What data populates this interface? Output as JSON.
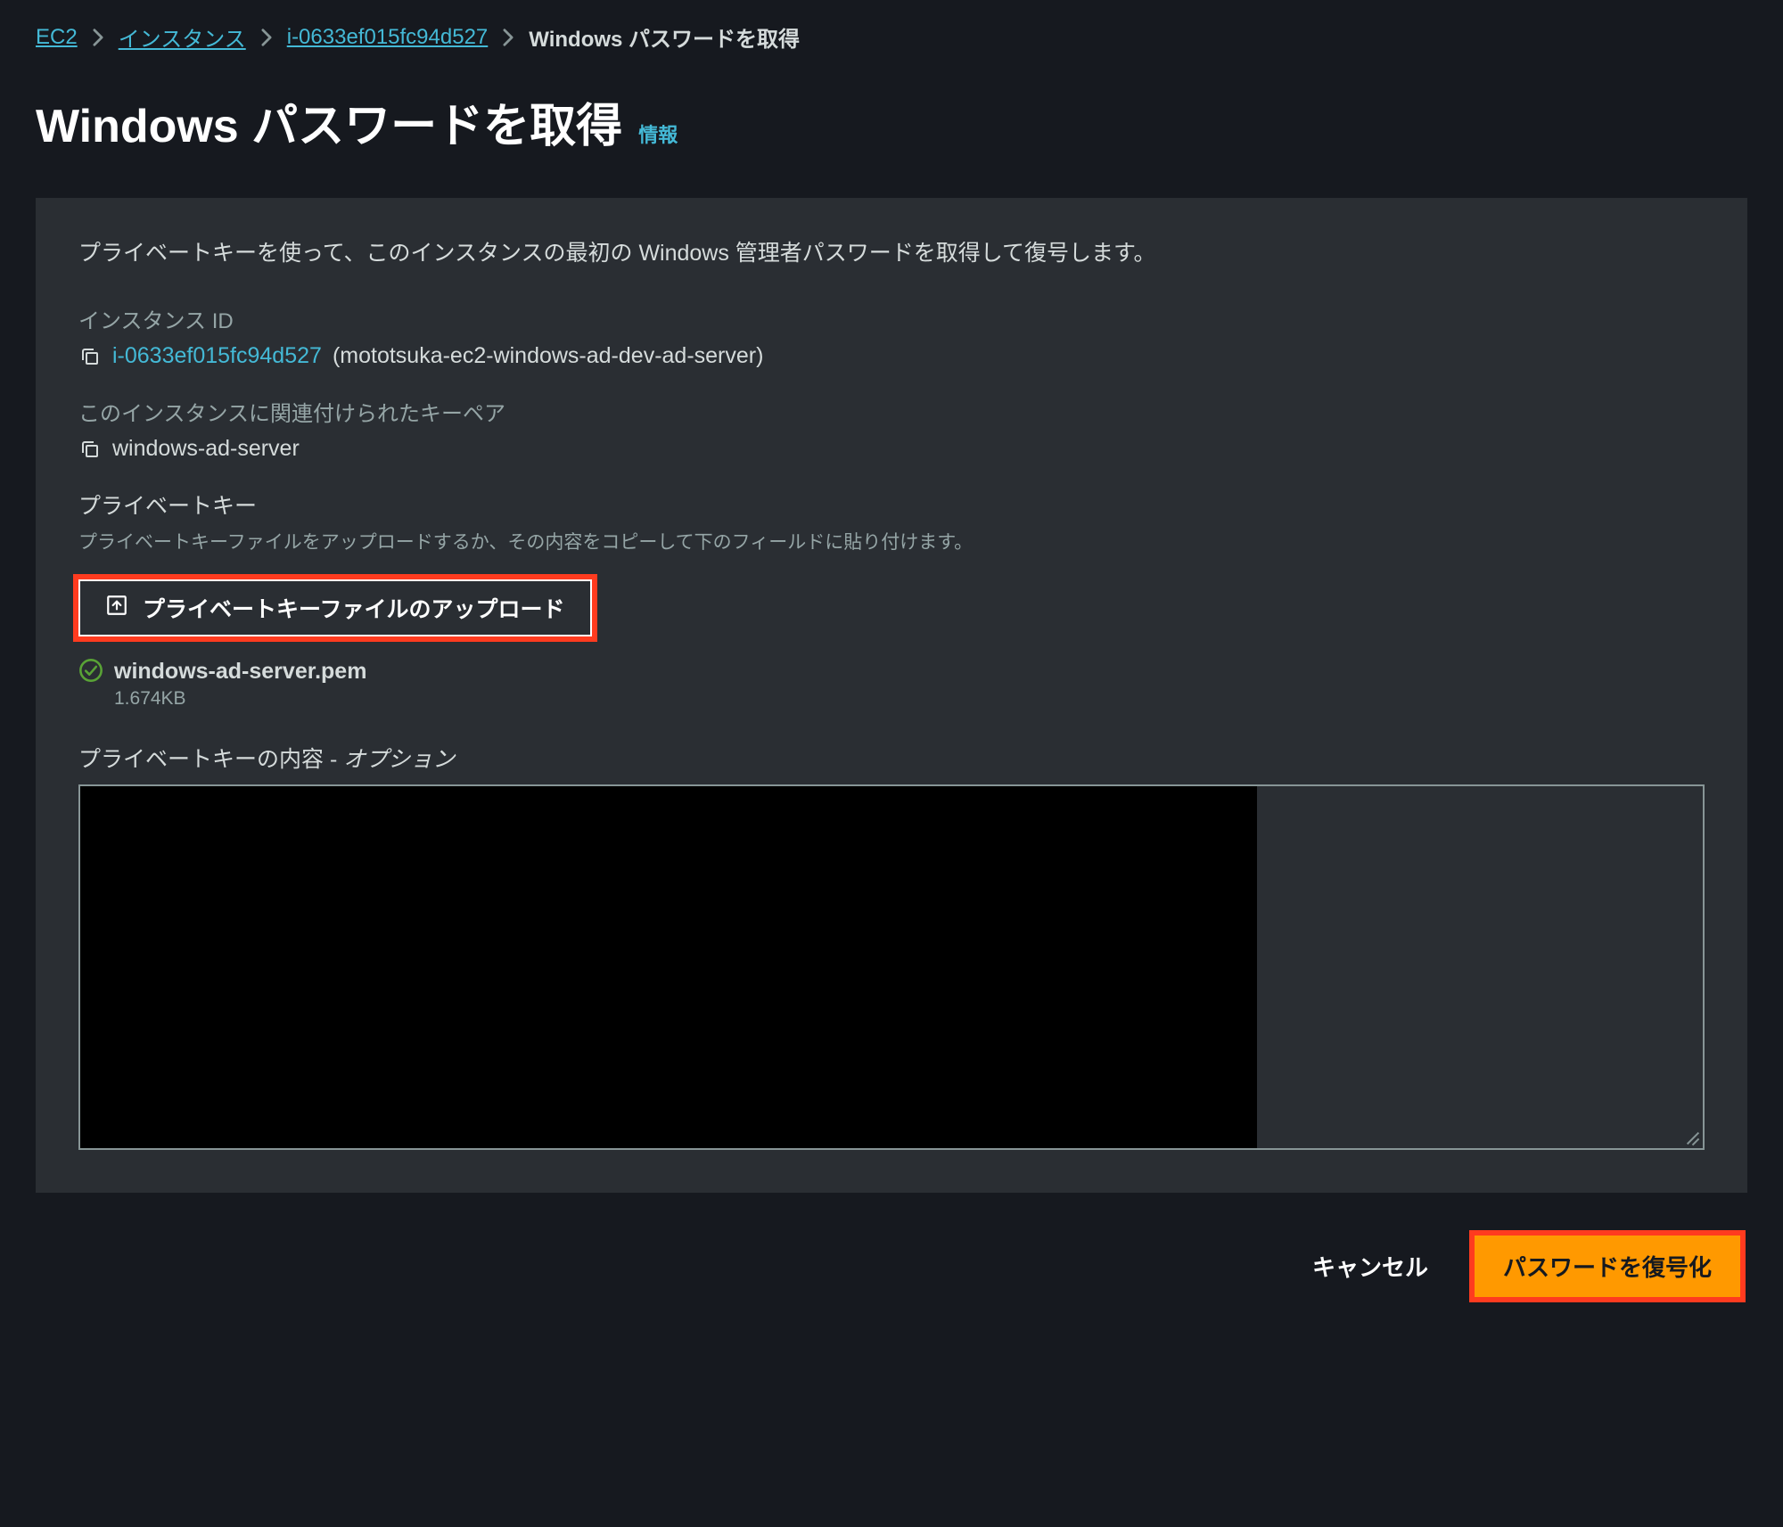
{
  "breadcrumb": {
    "items": [
      {
        "label": "EC2"
      },
      {
        "label": "インスタンス"
      },
      {
        "label": "i-0633ef015fc94d527"
      }
    ],
    "current": "Windows パスワードを取得"
  },
  "title": "Windows パスワードを取得",
  "info_link": "情報",
  "panel": {
    "intro": "プライベートキーを使って、このインスタンスの最初の Windows 管理者パスワードを取得して復号します。",
    "instance_id_label": "インスタンス ID",
    "instance_id": "i-0633ef015fc94d527",
    "instance_name_paren": "(mototsuka-ec2-windows-ad-dev-ad-server)",
    "keypair_label": "このインスタンスに関連付けられたキーペア",
    "keypair_name": "windows-ad-server",
    "private_key_title": "プライベートキー",
    "private_key_help": "プライベートキーファイルをアップロードするか、その内容をコピーして下のフィールドに貼り付けます。",
    "upload_button": "プライベートキーファイルのアップロード",
    "uploaded_file": {
      "name": "windows-ad-server.pem",
      "size": "1.674KB"
    },
    "content_label_prefix": "プライベートキーの内容 - ",
    "content_label_suffix": "オプション"
  },
  "footer": {
    "cancel": "キャンセル",
    "decrypt": "パスワードを復号化"
  },
  "colors": {
    "accent_link": "#44b9d6",
    "primary_button": "#ff9900",
    "highlight_outline": "#ff3b1f",
    "success": "#1d8102"
  }
}
